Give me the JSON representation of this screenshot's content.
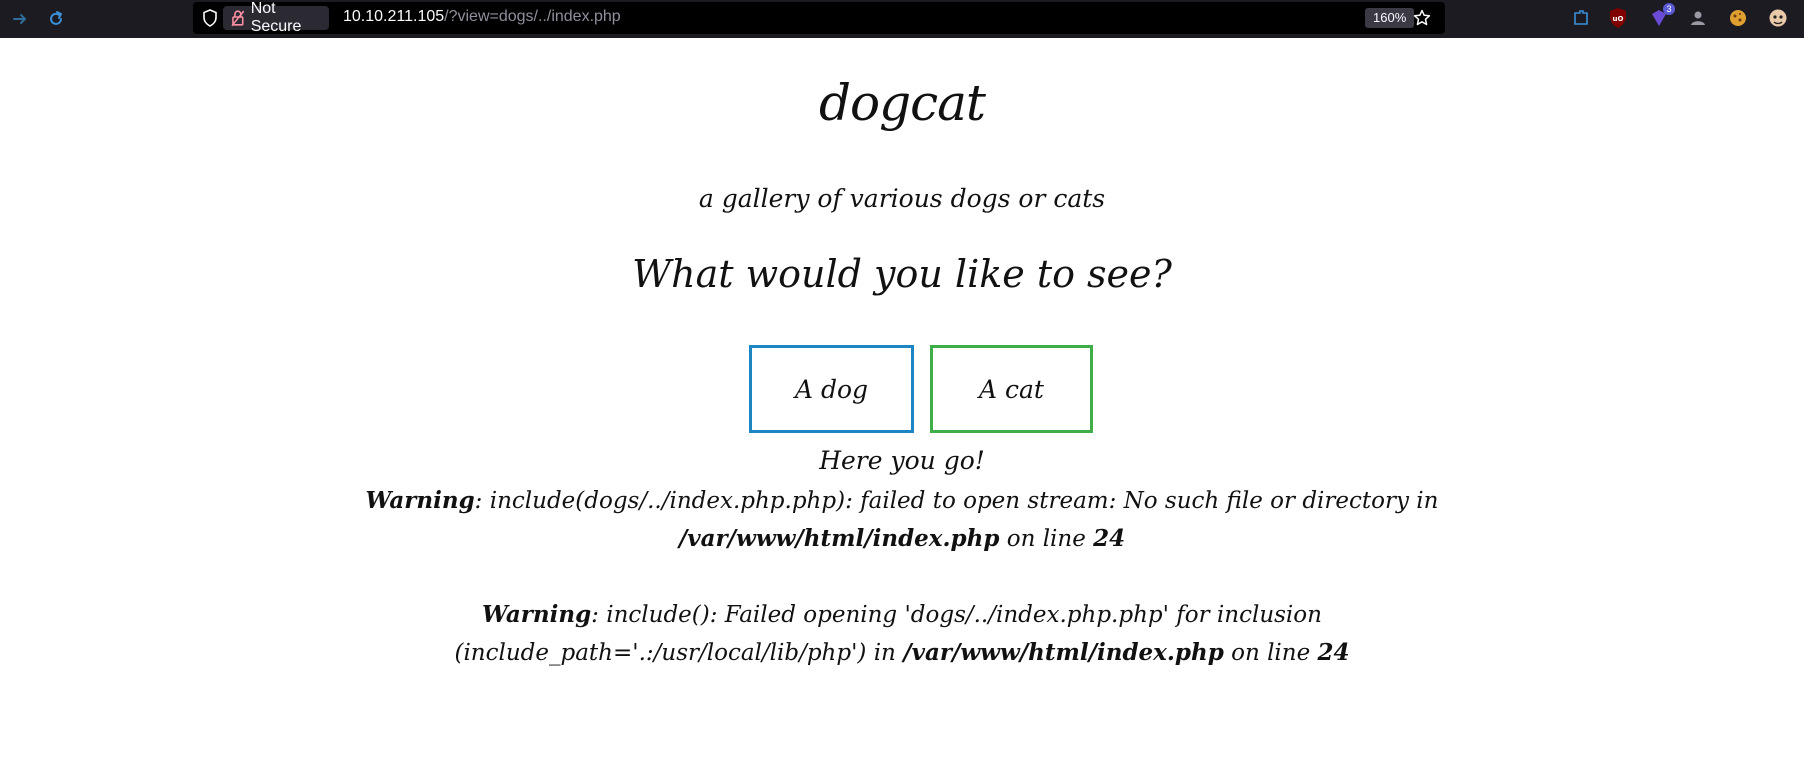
{
  "browser": {
    "security_label": "Not Secure",
    "url_host": "10.10.211.105",
    "url_path": "/?view=dogs/../index.php",
    "zoom": "160%",
    "extension_badge": "3"
  },
  "page": {
    "title": "dogcat",
    "subtitle": "a gallery of various dogs or cats",
    "question": "What would you like to see?",
    "dog_button": "A dog",
    "cat_button": "A cat",
    "result": "Here you go!",
    "warning1": {
      "label": "Warning",
      "text_a": ": include(dogs/../index.php.php): failed to open stream: No such file or directory in ",
      "file": "/var/www/html/index.php",
      "text_b": " on line ",
      "line": "24"
    },
    "warning2": {
      "label": "Warning",
      "text_a": ": include(): Failed opening 'dogs/../index.php.php' for inclusion (include_path='.:/usr/local/lib/php') in ",
      "file": "/var/www/html/index.php",
      "text_b": " on line ",
      "line": "24"
    }
  }
}
